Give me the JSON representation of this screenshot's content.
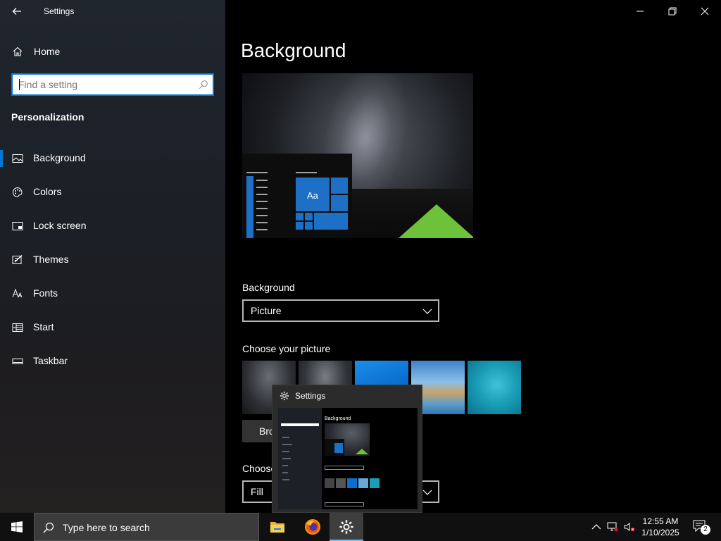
{
  "window": {
    "title": "Settings"
  },
  "sidebar": {
    "home_label": "Home",
    "search_placeholder": "Find a setting",
    "section_title": "Personalization",
    "items": [
      {
        "label": "Background",
        "icon": "picture-icon",
        "active": true
      },
      {
        "label": "Colors",
        "icon": "palette-icon",
        "active": false
      },
      {
        "label": "Lock screen",
        "icon": "lock-screen-icon",
        "active": false
      },
      {
        "label": "Themes",
        "icon": "themes-icon",
        "active": false
      },
      {
        "label": "Fonts",
        "icon": "fonts-icon",
        "active": false
      },
      {
        "label": "Start",
        "icon": "start-icon",
        "active": false
      },
      {
        "label": "Taskbar",
        "icon": "taskbar-icon",
        "active": false
      }
    ]
  },
  "main": {
    "page_title": "Background",
    "preview_tile_text": "Aa",
    "background_label": "Background",
    "background_value": "Picture",
    "choose_picture_label": "Choose your picture",
    "browse_label": "Bro",
    "choose_fit_label": "Choose",
    "fit_value": "Fill"
  },
  "hover_preview": {
    "title": "Settings",
    "mini_page_title": "Background"
  },
  "taskbar": {
    "search_text": "Type here to search",
    "time": "12:55 AM",
    "date": "1/10/2025",
    "notification_count": "2",
    "apps": [
      "file-explorer-icon",
      "firefox-icon",
      "settings-icon"
    ]
  },
  "colors": {
    "accent": "#0078d7",
    "tile_blue": "#1e6fc6",
    "tent_green": "#6dc23a"
  }
}
